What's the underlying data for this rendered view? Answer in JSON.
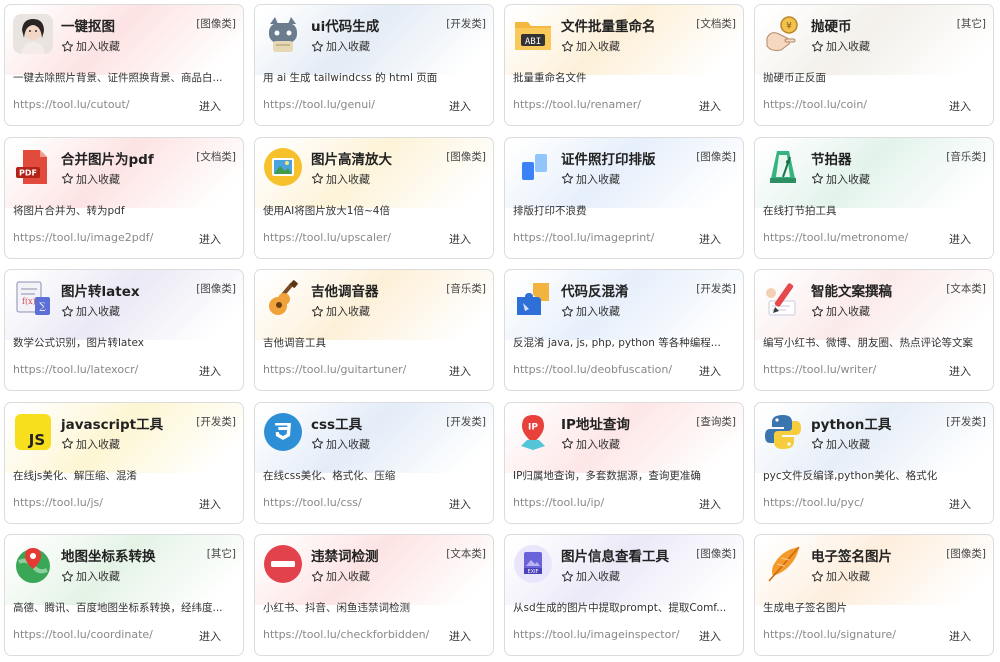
{
  "cards": [
    {
      "title": "一键抠图",
      "tag": "[图像类]",
      "fav": "加入收藏",
      "desc": "一键去除照片背景、证件照换背景、商品白...",
      "url": "https://tool.lu/cutout/",
      "enter": "进入",
      "icon": "portrait-icon",
      "tint": "#fde3e3"
    },
    {
      "title": "ui代码生成",
      "tag": "[开发类]",
      "fav": "加入收藏",
      "desc": "用 ai 生成 tailwindcss 的 html 页面",
      "url": "https://tool.lu/genui/",
      "enter": "进入",
      "icon": "robot-cat-icon",
      "tint": "#e3ebf5"
    },
    {
      "title": "文件批量重命名",
      "tag": "[文档类]",
      "fav": "加入收藏",
      "desc": "批量重命名文件",
      "url": "https://tool.lu/renamer/",
      "enter": "进入",
      "icon": "folder-abc-icon",
      "tint": "#fdf0d8"
    },
    {
      "title": "抛硬币",
      "tag": "[其它]",
      "fav": "加入收藏",
      "desc": "抛硬币正反面",
      "url": "https://tool.lu/coin/",
      "enter": "进入",
      "icon": "coin-toss-icon",
      "tint": "#f3f0ea"
    },
    {
      "title": "合并图片为pdf",
      "tag": "[文档类]",
      "fav": "加入收藏",
      "desc": "将图片合并为、转为pdf",
      "url": "https://tool.lu/image2pdf/",
      "enter": "进入",
      "icon": "pdf-icon",
      "tint": "#fde3e3"
    },
    {
      "title": "图片高清放大",
      "tag": "[图像类]",
      "fav": "加入收藏",
      "desc": "使用AI将图片放大1倍~4倍",
      "url": "https://tool.lu/upscaler/",
      "enter": "进入",
      "icon": "image-upscale-icon",
      "tint": "#fdf3d8"
    },
    {
      "title": "证件照打印排版",
      "tag": "[图像类]",
      "fav": "加入收藏",
      "desc": "排版打印不浪费",
      "url": "https://tool.lu/imageprint/",
      "enter": "进入",
      "icon": "id-photo-print-icon",
      "tint": "#e6effb"
    },
    {
      "title": "节拍器",
      "tag": "[音乐类]",
      "fav": "加入收藏",
      "desc": "在线打节拍工具",
      "url": "https://tool.lu/metronome/",
      "enter": "进入",
      "icon": "metronome-icon",
      "tint": "#e3f3ec"
    },
    {
      "title": "图片转latex",
      "tag": "[图像类]",
      "fav": "加入收藏",
      "desc": "数学公式识别，图片转latex",
      "url": "https://tool.lu/latexocr/",
      "enter": "进入",
      "icon": "formula-sheet-icon",
      "tint": "#eae9f5"
    },
    {
      "title": "吉他调音器",
      "tag": "[音乐类]",
      "fav": "加入收藏",
      "desc": "吉他调音工具",
      "url": "https://tool.lu/guitartuner/",
      "enter": "进入",
      "icon": "guitar-icon",
      "tint": "#fdf0d8"
    },
    {
      "title": "代码反混淆",
      "tag": "[开发类]",
      "fav": "加入收藏",
      "desc": "反混淆 java, js, php, python 等各种编程...",
      "url": "https://tool.lu/deobfuscation/",
      "enter": "进入",
      "icon": "puzzle-icon",
      "tint": "#e6effb"
    },
    {
      "title": "智能文案撰稿",
      "tag": "[文本类]",
      "fav": "加入收藏",
      "desc": "编写小红书、微博、朋友圈、热点评论等文案",
      "url": "https://tool.lu/writer/",
      "enter": "进入",
      "icon": "pen-writing-icon",
      "tint": "#fbeaea"
    },
    {
      "title": "javascript工具",
      "tag": "[开发类]",
      "fav": "加入收藏",
      "desc": "在线js美化、解压缩、混淆",
      "url": "https://tool.lu/js/",
      "enter": "进入",
      "icon": "js-icon",
      "tint": "#fdf6d3"
    },
    {
      "title": "css工具",
      "tag": "[开发类]",
      "fav": "加入收藏",
      "desc": "在线css美化、格式化、压缩",
      "url": "https://tool.lu/css/",
      "enter": "进入",
      "icon": "css3-icon",
      "tint": "#e3ecf8"
    },
    {
      "title": "IP地址查询",
      "tag": "[查询类]",
      "fav": "加入收藏",
      "desc": "IP归属地查询，多套数据源，查询更准确",
      "url": "https://tool.lu/ip/",
      "enter": "进入",
      "icon": "ip-location-icon",
      "tint": "#fde6e6"
    },
    {
      "title": "python工具",
      "tag": "[开发类]",
      "fav": "加入收藏",
      "desc": "pyc文件反编译,python美化、格式化",
      "url": "https://tool.lu/pyc/",
      "enter": "进入",
      "icon": "python-icon",
      "tint": "#e6eef8"
    },
    {
      "title": "地图坐标系转换",
      "tag": "[其它]",
      "fav": "加入收藏",
      "desc": "高德、腾讯、百度地图坐标系转换，经纬度...",
      "url": "https://tool.lu/coordinate/",
      "enter": "进入",
      "icon": "map-pin-icon",
      "tint": "#e4f3e6"
    },
    {
      "title": "违禁词检测",
      "tag": "[文本类]",
      "fav": "加入收藏",
      "desc": "小红书、抖音、闲鱼违禁词检测",
      "url": "https://tool.lu/checkforbidden/",
      "enter": "进入",
      "icon": "no-entry-icon",
      "tint": "#fde3e3"
    },
    {
      "title": "图片信息查看工具",
      "tag": "[图像类]",
      "fav": "加入收藏",
      "desc": "从sd生成的图片中提取prompt、提取Comf...",
      "url": "https://tool.lu/imageinspector/",
      "enter": "进入",
      "icon": "exif-icon",
      "tint": "#ece9f8"
    },
    {
      "title": "电子签名图片",
      "tag": "[图像类]",
      "fav": "加入收藏",
      "desc": "生成电子签名图片",
      "url": "https://tool.lu/signature/",
      "enter": "进入",
      "icon": "feather-quill-icon",
      "tint": "#fdeedd"
    }
  ]
}
